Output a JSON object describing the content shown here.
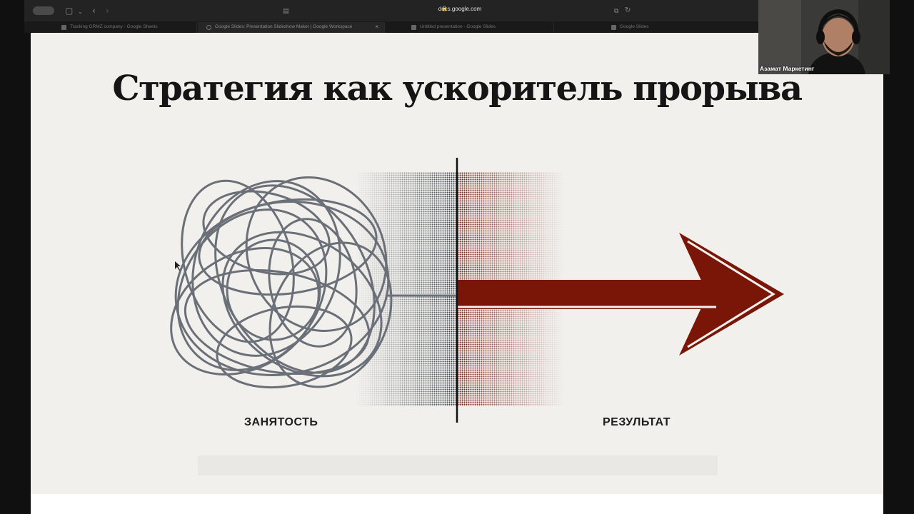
{
  "browser": {
    "address": "docs.google.com",
    "tabs": [
      {
        "label": "Tracking GRMZ company - Google Sheets",
        "active": false,
        "favicon": "sheets-icon"
      },
      {
        "label": "Google Slides: Presentation Slideshow Maker | Google Workspace",
        "active": true,
        "favicon": "google-icon"
      },
      {
        "label": "Untitled presentation - Google Slides",
        "active": false,
        "favicon": "slides-icon"
      },
      {
        "label": "Google Slides",
        "active": false,
        "favicon": "slides-icon"
      }
    ]
  },
  "slide": {
    "title": "Стратегия как ускоритель прорыва",
    "left_label": "ЗАНЯТОСТЬ",
    "right_label": "РЕЗУЛЬТАТ",
    "colors": {
      "tangle": "#6b7078",
      "arrow": "#7a1608",
      "divider": "#111111",
      "background": "#f1f0ed"
    }
  },
  "webcam": {
    "name": "Азамат Маркетинг"
  }
}
